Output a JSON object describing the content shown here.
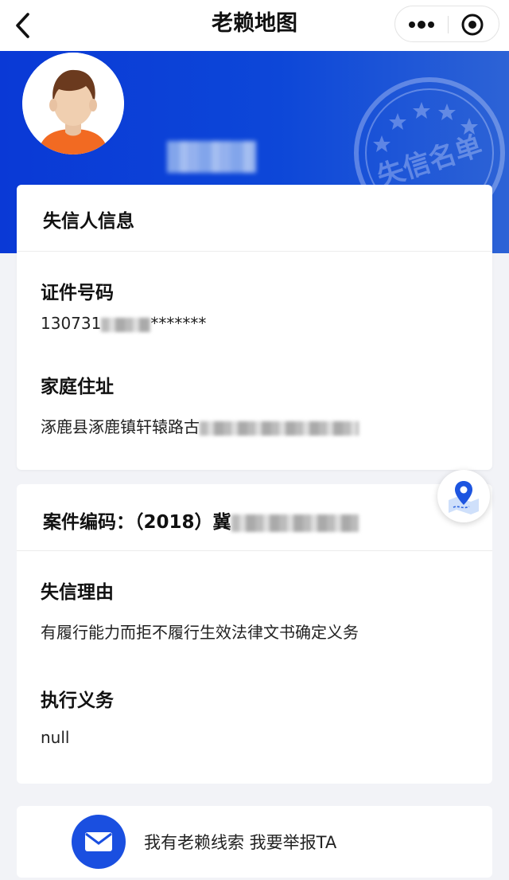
{
  "nav": {
    "title": "老赖地图",
    "back_icon": "chevron-left-icon",
    "more_icon": "more-dots-icon",
    "close_icon": "target-icon"
  },
  "header": {
    "stamp_text": "失信名单",
    "avatar_icon": "person-avatar-icon"
  },
  "person_card": {
    "title": "失信人信息",
    "id_label": "证件号码",
    "id_prefix": "130731",
    "id_suffix": "*******",
    "address_label": "家庭住址",
    "address_value": "涿鹿县涿鹿镇轩辕路古"
  },
  "case_card": {
    "case_label": "案件编码：（2018）冀",
    "reason_label": "失信理由",
    "reason_value": "有履行能力而拒不履行生效法律文书确定义务",
    "duty_label": "执行义务",
    "duty_value": "null"
  },
  "map_button_icon": "map-pin-icon",
  "report": {
    "text": "我有老赖线索 我要举报TA",
    "icon": "mail-icon"
  },
  "colors": {
    "band": "#0a39d6",
    "accent": "#1a4fe0"
  }
}
